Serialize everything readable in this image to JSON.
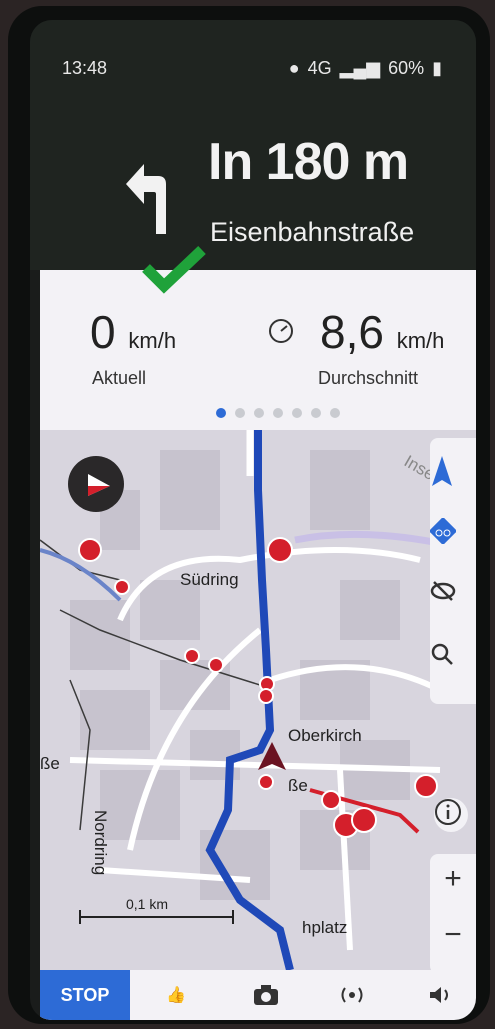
{
  "status": {
    "time": "13:48",
    "signal": "4G",
    "battery": "60%"
  },
  "navigation": {
    "distance": "In 180 m",
    "street": "Eisenbahnstraße"
  },
  "speed": {
    "current_value": "0",
    "current_unit": "km/h",
    "current_label": "Aktuell",
    "average_value": "8,6",
    "average_unit": "km/h",
    "average_label": "Durchschnitt",
    "pages": 7,
    "active_page": 0
  },
  "map": {
    "labels": {
      "suedring": "Südring",
      "oberkirch": "Oberkirch",
      "nordring": "Nordring",
      "partial_street": "ße",
      "partial_street2": "ße",
      "platz": "hplatz",
      "insel": "Inselwadw"
    },
    "scale_label": "0,1 km"
  },
  "controls": {
    "zoom_in": "+",
    "zoom_out": "−"
  },
  "bottom_bar": {
    "stop_label": "STOP"
  },
  "colors": {
    "route": "#1f49b8",
    "accent": "#2d6bd6",
    "poi": "#d41f2b",
    "check": "#1fa23a"
  }
}
